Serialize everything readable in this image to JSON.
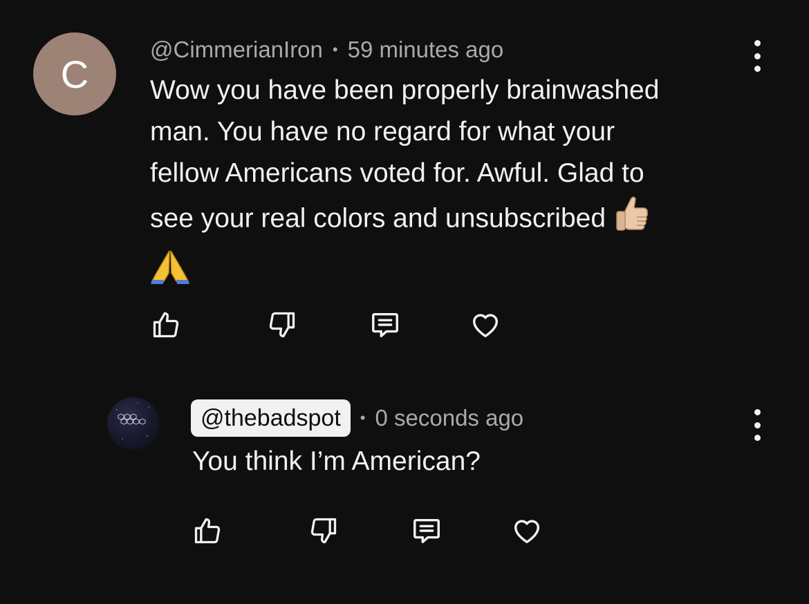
{
  "comments": [
    {
      "avatar_letter": "C",
      "avatar_color": "#9c8376",
      "handle": "@CimmerianIron",
      "separator": "•",
      "time": "59 minutes ago",
      "text": "Wow you have been properly brainwashed\nman. You have no regard for what your\nfellow Americans voted for. Awful. Glad to\nsee your real colors and unsubscribed",
      "emoji_inline": "thumbs-up",
      "emoji_after": "folded-hands",
      "actions": [
        "like-icon",
        "dislike-icon",
        "reply-icon",
        "heart-icon"
      ]
    },
    {
      "avatar_image": "the-bad-spot-logo",
      "avatar_logo_text": "THE BAD SPOT",
      "handle": "@thebadspot",
      "separator": "•",
      "time": "0 seconds ago",
      "text": "You think I’m American?",
      "actions": [
        "like-icon",
        "dislike-icon",
        "reply-icon",
        "heart-icon"
      ]
    }
  ],
  "colors": {
    "background": "#0f0f0f",
    "text": "#f1f1f1",
    "meta": "#aaaaaa"
  }
}
